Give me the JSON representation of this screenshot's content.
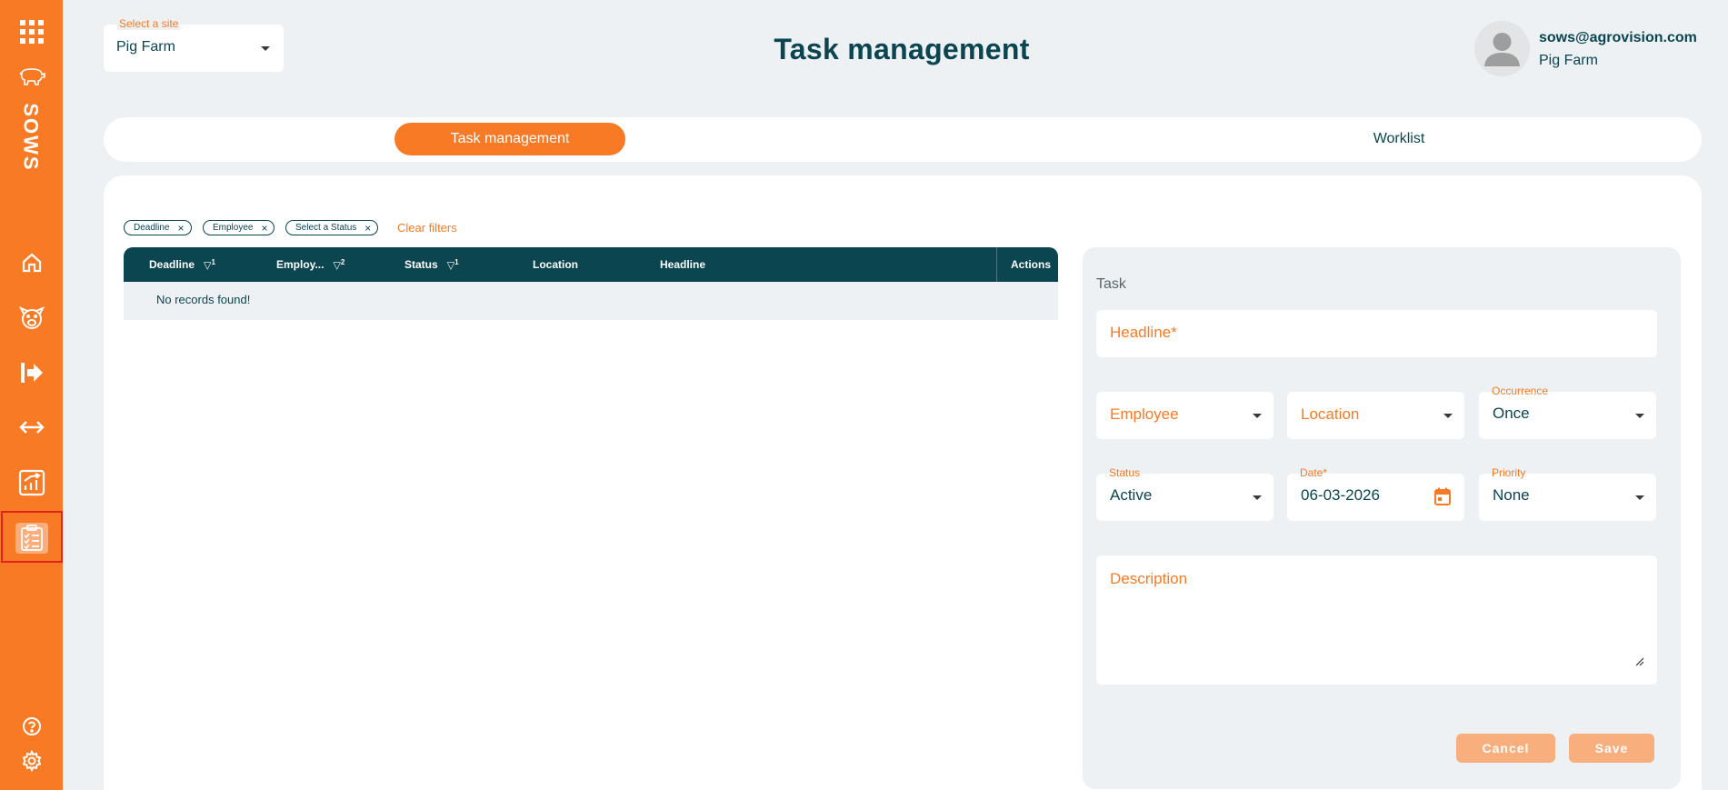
{
  "sidebar": {
    "brand": "SOWS",
    "items": [
      {
        "name": "apps-grid-icon"
      },
      {
        "name": "pig-icon"
      },
      {
        "name": "home-icon"
      },
      {
        "name": "piglet-face-icon"
      },
      {
        "name": "exit-arrow-icon"
      },
      {
        "name": "transfer-arrows-icon"
      },
      {
        "name": "analytics-icon"
      },
      {
        "name": "clipboard-tasks-icon",
        "active": true
      },
      {
        "name": "help-icon"
      },
      {
        "name": "settings-icon"
      }
    ]
  },
  "header": {
    "site_select": {
      "label": "Select a site",
      "value": "Pig Farm"
    },
    "title": "Task management",
    "user": {
      "email": "sows@agrovision.com",
      "site": "Pig Farm"
    }
  },
  "tabs": [
    {
      "label": "Task management",
      "active": true
    },
    {
      "label": "Worklist",
      "active": false
    }
  ],
  "filters": {
    "chips": [
      "Deadline",
      "Employee",
      "Select a Status"
    ],
    "clear_label": "Clear filters"
  },
  "table": {
    "columns": [
      {
        "label": "Deadline",
        "sort": "1"
      },
      {
        "label": "Employ...",
        "sort": "2"
      },
      {
        "label": "Status",
        "sort": "1"
      },
      {
        "label": "Location"
      },
      {
        "label": "Headline"
      },
      {
        "label": "Actions"
      }
    ],
    "empty_message": "No records found!"
  },
  "task_form": {
    "title": "Task",
    "headline_placeholder": "Headline*",
    "employee_placeholder": "Employee",
    "location_placeholder": "Location",
    "occurrence": {
      "label": "Occurrence",
      "value": "Once"
    },
    "status": {
      "label": "Status",
      "value": "Active"
    },
    "date": {
      "label": "Date*",
      "value": "06-03-2026"
    },
    "priority": {
      "label": "Priority",
      "value": "None"
    },
    "description_placeholder": "Description",
    "cancel_label": "Cancel",
    "save_label": "Save"
  },
  "colors": {
    "accent": "#f97a25",
    "dark_teal": "#0b4550",
    "background": "#edf1f4",
    "button_disabled": "#f9ae7e",
    "active_highlight": "#e0231c"
  }
}
